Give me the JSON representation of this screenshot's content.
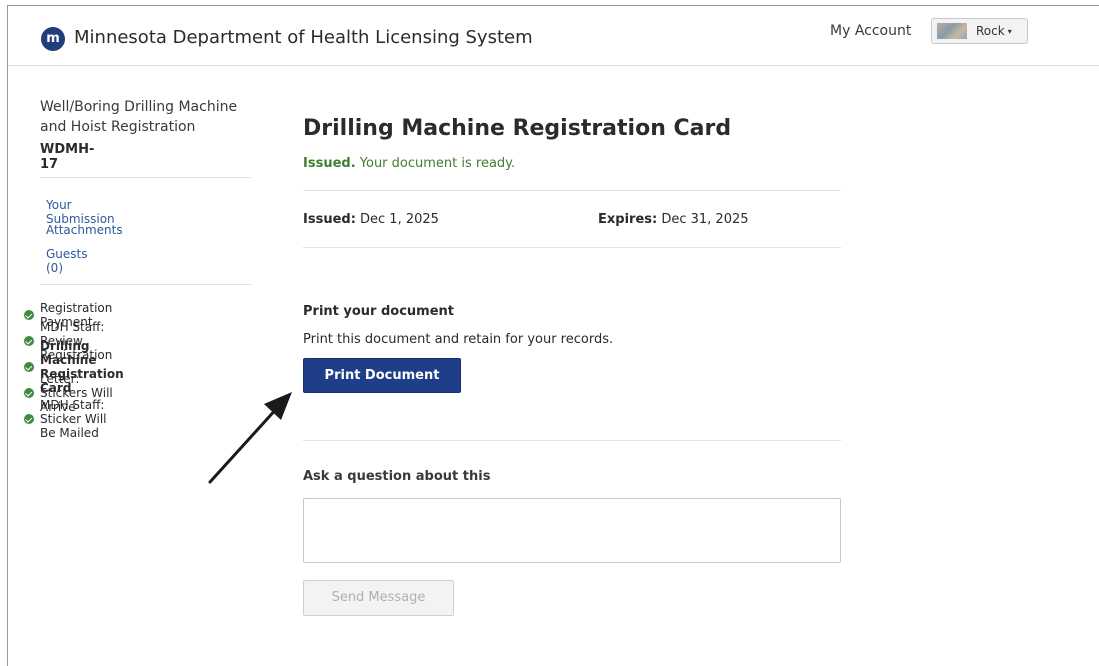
{
  "header": {
    "logo_letter": "m",
    "app_title": "Minnesota Department of Health Licensing System",
    "my_account": "My Account",
    "user_name": "Rock",
    "caret": "▾"
  },
  "sidebar": {
    "registration_title": "Well/Boring Drilling Machine and Hoist Registration",
    "registration_code": "WDMH-17",
    "links": [
      {
        "label": "Your Submission"
      },
      {
        "label": "Attachments"
      },
      {
        "label": "Guests (0)"
      }
    ],
    "steps": [
      {
        "label": "Registration Payment",
        "status": "complete"
      },
      {
        "label": "MDH Staff: Review Registration",
        "status": "complete"
      },
      {
        "label": "Drilling Machine Registration Card",
        "status": "complete",
        "active": true
      },
      {
        "label": "Letter: Stickers Will Arrive",
        "status": "complete"
      },
      {
        "label": "MDH Staff: Sticker Will Be Mailed",
        "status": "complete"
      }
    ]
  },
  "main": {
    "title": "Drilling Machine Registration Card",
    "status_strong": "Issued.",
    "status_text": " Your document is ready.",
    "issued_label": "Issued:",
    "issued_value": " Dec 1, 2025",
    "expires_label": "Expires:",
    "expires_value": " Dec 31, 2025",
    "print_heading": "Print your document",
    "print_desc": "Print this document and retain for your records.",
    "print_button": "Print Document",
    "ask_heading": "Ask a question about this",
    "message_value": "",
    "send_button": "Send Message"
  },
  "colors": {
    "primary_button": "#1f3e8a",
    "status_green": "#3f7f2d",
    "link_blue": "#2d5a9e",
    "check_green": "#3f8a3f"
  }
}
